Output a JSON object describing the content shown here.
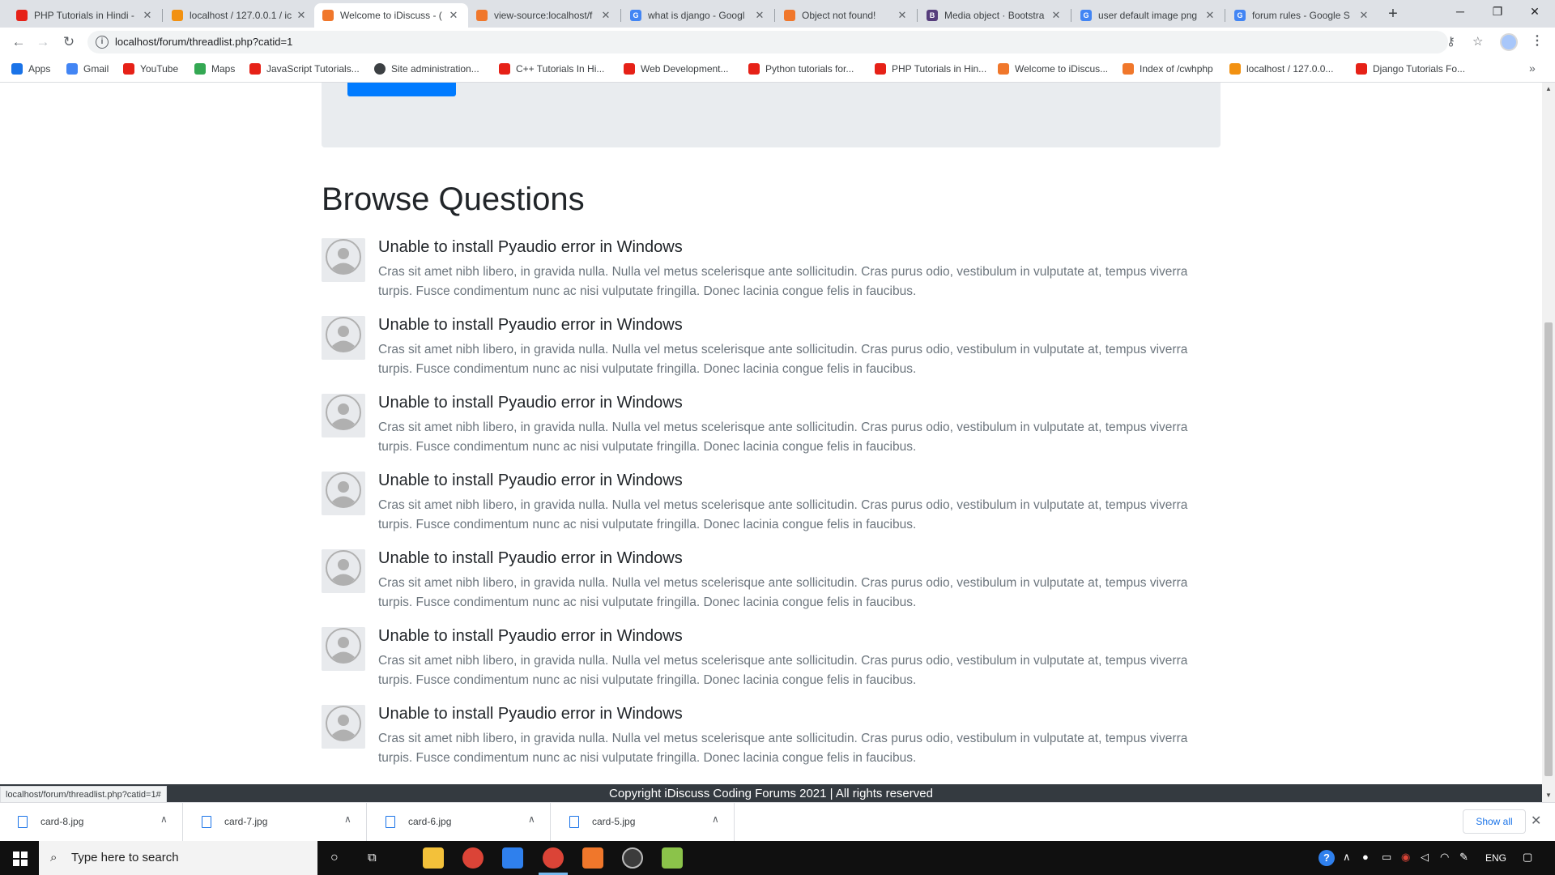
{
  "browser": {
    "tabs": [
      {
        "title": "PHP Tutorials in Hindi - ",
        "favicon_color": "#e62117",
        "active": false
      },
      {
        "title": "localhost / 127.0.0.1 / ic",
        "favicon_color": "#f29111",
        "active": false
      },
      {
        "title": "Welcome to iDiscuss - (",
        "favicon_color": "#f0772b",
        "active": true
      },
      {
        "title": "view-source:localhost/f",
        "favicon_color": "#f0772b",
        "active": false
      },
      {
        "title": "what is django - Googl",
        "favicon_color": "#4285f4",
        "active": false
      },
      {
        "title": "Object not found!",
        "favicon_color": "#f0772b",
        "active": false
      },
      {
        "title": "Media object · Bootstra",
        "favicon_color": "#563d7c",
        "active": false
      },
      {
        "title": "user default image png",
        "favicon_color": "#4285f4",
        "active": false
      },
      {
        "title": "forum rules - Google S",
        "favicon_color": "#4285f4",
        "active": false
      }
    ],
    "url": "localhost/forum/threadlist.php?catid=1",
    "bookmarks": [
      {
        "label": "Apps",
        "icon_color": "#1a73e8"
      },
      {
        "label": "Gmail",
        "icon_color": "#4285f4"
      },
      {
        "label": "YouTube",
        "icon_color": "#e62117"
      },
      {
        "label": "Maps",
        "icon_color": "#34a853"
      },
      {
        "label": "JavaScript Tutorials...",
        "icon_color": "#e62117"
      },
      {
        "label": "Site administration...",
        "icon_color": "#3c4043"
      },
      {
        "label": "C++ Tutorials In Hi...",
        "icon_color": "#e62117"
      },
      {
        "label": "Web Development...",
        "icon_color": "#e62117"
      },
      {
        "label": "Python tutorials for...",
        "icon_color": "#e62117"
      },
      {
        "label": "PHP Tutorials in Hin...",
        "icon_color": "#e62117"
      },
      {
        "label": "Welcome to iDiscus...",
        "icon_color": "#f0772b"
      },
      {
        "label": "Index of /cwhphp",
        "icon_color": "#f0772b"
      },
      {
        "label": "localhost / 127.0.0...",
        "icon_color": "#f29111"
      },
      {
        "label": "Django Tutorials Fo...",
        "icon_color": "#e62117"
      }
    ]
  },
  "page": {
    "browse_title": "Browse Questions",
    "questions": [
      {
        "title": "Unable to install Pyaudio error in Windows",
        "desc": "Cras sit amet nibh libero, in gravida nulla. Nulla vel metus scelerisque ante sollicitudin. Cras purus odio, vestibulum in vulputate at, tempus viverra turpis. Fusce condimentum nunc ac nisi vulputate fringilla. Donec lacinia congue felis in faucibus."
      },
      {
        "title": "Unable to install Pyaudio error in Windows",
        "desc": "Cras sit amet nibh libero, in gravida nulla. Nulla vel metus scelerisque ante sollicitudin. Cras purus odio, vestibulum in vulputate at, tempus viverra turpis. Fusce condimentum nunc ac nisi vulputate fringilla. Donec lacinia congue felis in faucibus."
      },
      {
        "title": "Unable to install Pyaudio error in Windows",
        "desc": "Cras sit amet nibh libero, in gravida nulla. Nulla vel metus scelerisque ante sollicitudin. Cras purus odio, vestibulum in vulputate at, tempus viverra turpis. Fusce condimentum nunc ac nisi vulputate fringilla. Donec lacinia congue felis in faucibus."
      },
      {
        "title": "Unable to install Pyaudio error in Windows",
        "desc": "Cras sit amet nibh libero, in gravida nulla. Nulla vel metus scelerisque ante sollicitudin. Cras purus odio, vestibulum in vulputate at, tempus viverra turpis. Fusce condimentum nunc ac nisi vulputate fringilla. Donec lacinia congue felis in faucibus."
      },
      {
        "title": "Unable to install Pyaudio error in Windows",
        "desc": "Cras sit amet nibh libero, in gravida nulla. Nulla vel metus scelerisque ante sollicitudin. Cras purus odio, vestibulum in vulputate at, tempus viverra turpis. Fusce condimentum nunc ac nisi vulputate fringilla. Donec lacinia congue felis in faucibus."
      },
      {
        "title": "Unable to install Pyaudio error in Windows",
        "desc": "Cras sit amet nibh libero, in gravida nulla. Nulla vel metus scelerisque ante sollicitudin. Cras purus odio, vestibulum in vulputate at, tempus viverra turpis. Fusce condimentum nunc ac nisi vulputate fringilla. Donec lacinia congue felis in faucibus."
      },
      {
        "title": "Unable to install Pyaudio error in Windows",
        "desc": "Cras sit amet nibh libero, in gravida nulla. Nulla vel metus scelerisque ante sollicitudin. Cras purus odio, vestibulum in vulputate at, tempus viverra turpis. Fusce condimentum nunc ac nisi vulputate fringilla. Donec lacinia congue felis in faucibus."
      }
    ],
    "footer": "Copyright iDiscuss Coding Forums 2021 | All rights reserved",
    "status_url": "localhost/forum/threadlist.php?catid=1#"
  },
  "downloads": {
    "items": [
      {
        "name": "card-8.jpg"
      },
      {
        "name": "card-7.jpg"
      },
      {
        "name": "card-6.jpg"
      },
      {
        "name": "card-5.jpg"
      }
    ],
    "show_all": "Show all"
  },
  "taskbar": {
    "search_placeholder": "Type here to search",
    "lang": "ENG",
    "apps": [
      {
        "name": "file-explorer",
        "color": "#f3c13a"
      },
      {
        "name": "chrome",
        "color": "#db4437"
      },
      {
        "name": "vscode",
        "color": "#2f80ed"
      },
      {
        "name": "chrome-active",
        "color": "#db4437"
      },
      {
        "name": "xampp",
        "color": "#f0772b"
      },
      {
        "name": "obs",
        "color": "#3c3c3c"
      },
      {
        "name": "notepad",
        "color": "#8bc34a"
      }
    ]
  },
  "colors": {
    "primary": "#007bff",
    "footer_bg": "#343a40",
    "jumbotron_bg": "#e9ecef"
  }
}
